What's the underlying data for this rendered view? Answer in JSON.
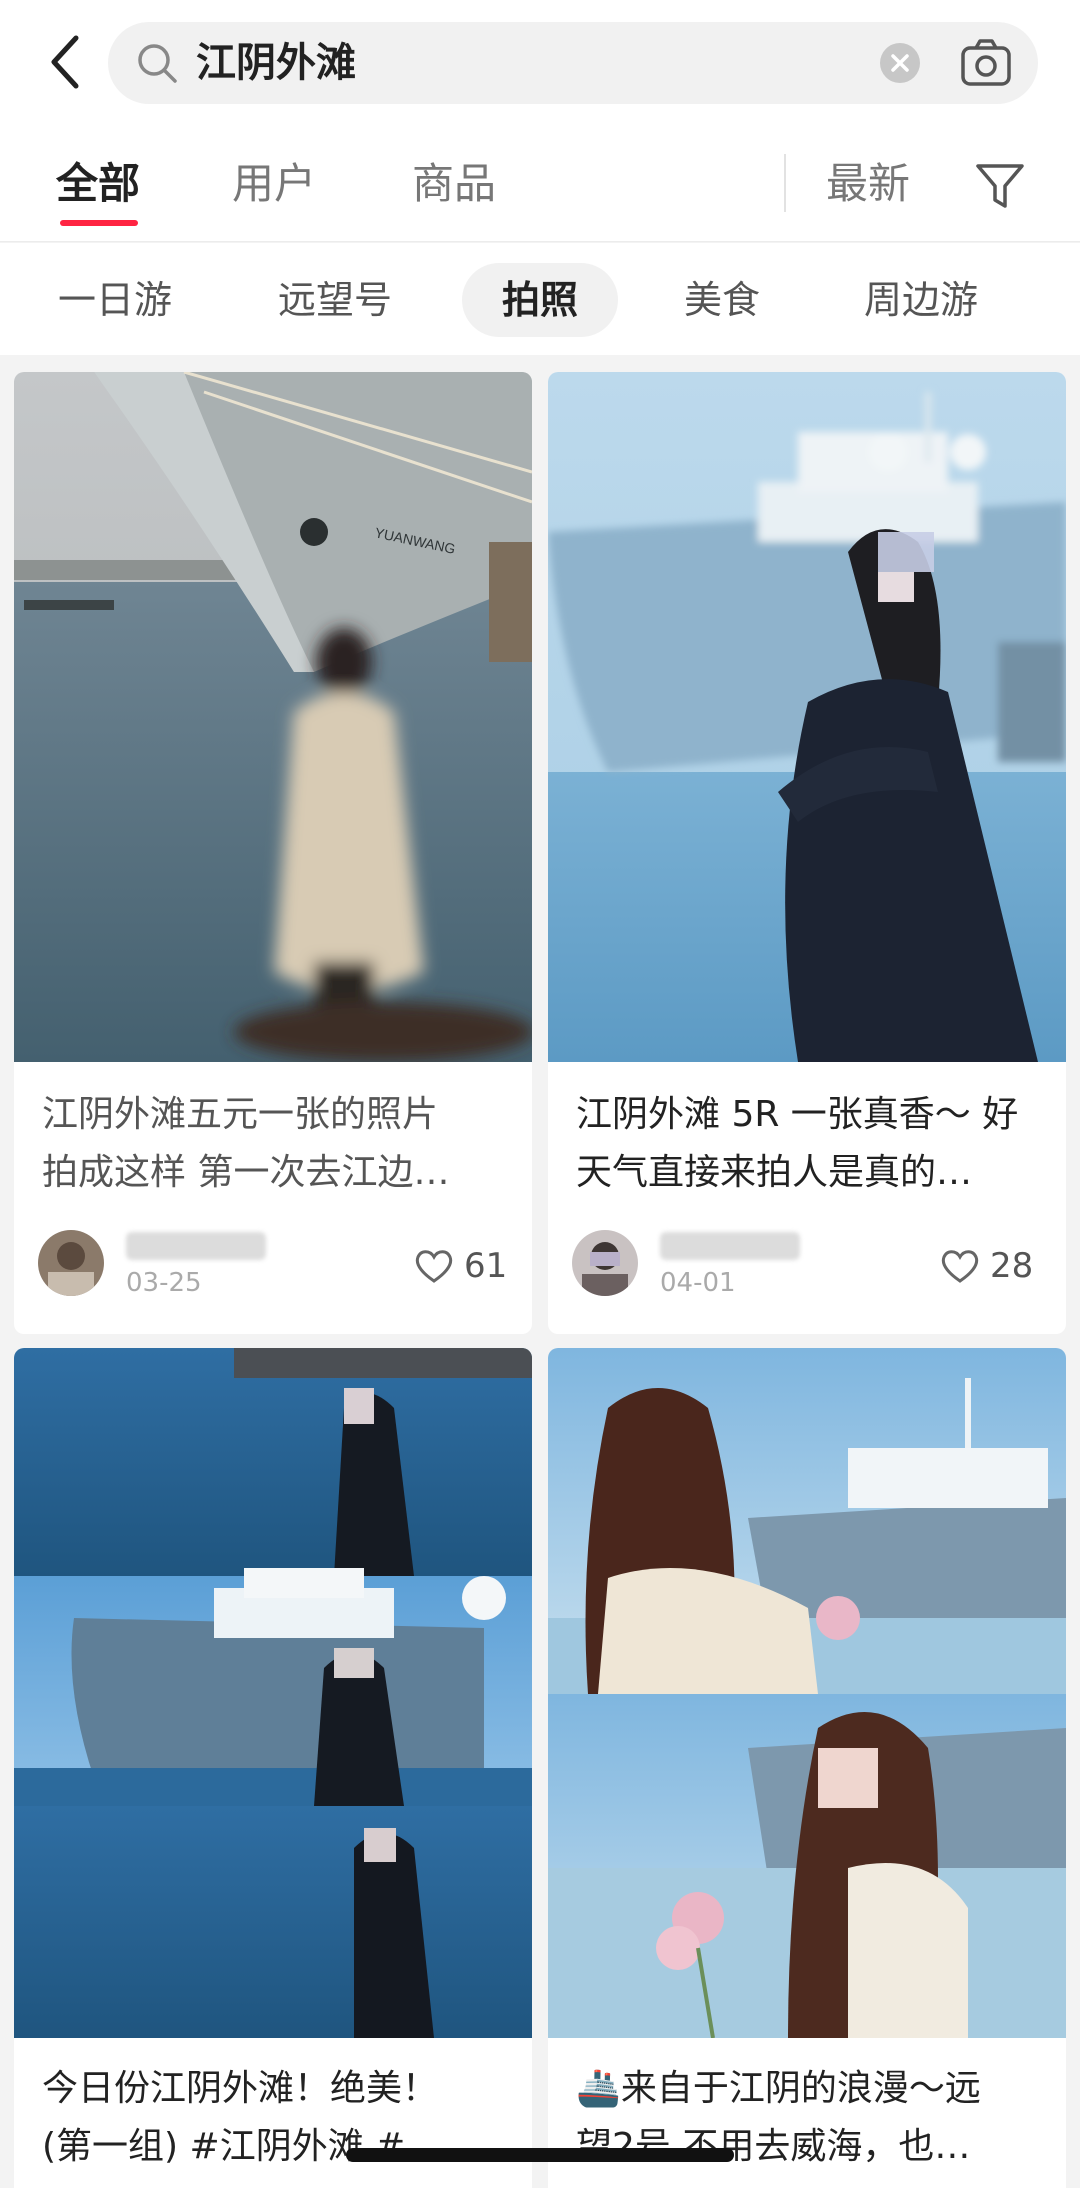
{
  "search": {
    "query": "江阴外滩",
    "back_icon": "chevron-left-icon",
    "search_icon": "search-icon",
    "clear_icon": "close-circle-icon",
    "camera_icon": "camera-icon"
  },
  "tabs": {
    "items": [
      "全部",
      "用户",
      "商品"
    ],
    "active_index": 0,
    "sort_label": "最新",
    "filter_icon": "filter-icon",
    "accent": "#ff2442"
  },
  "chips": {
    "items": [
      "一日游",
      "远望号",
      "拍照",
      "美食",
      "周边游"
    ],
    "active_index": 2
  },
  "feed": [
    {
      "title_line1": "江阴外滩五元一张的照片",
      "title_line2": "拍成这样 第一次去江边…",
      "date": "03-25",
      "likes": "61"
    },
    {
      "title_line1": "江阴外滩 5R 一张真香～ 好",
      "title_line2": "天气直接来拍人是真的…",
      "date": "04-01",
      "likes": "28"
    },
    {
      "title_line1": "今日份江阴外滩！绝美！",
      "title_line2": "(第一组) #江阴外滩 #…"
    },
    {
      "title_line1": "🚢来自于江阴的浪漫～远",
      "title_line2": "望2号 不用去威海，也…"
    }
  ]
}
